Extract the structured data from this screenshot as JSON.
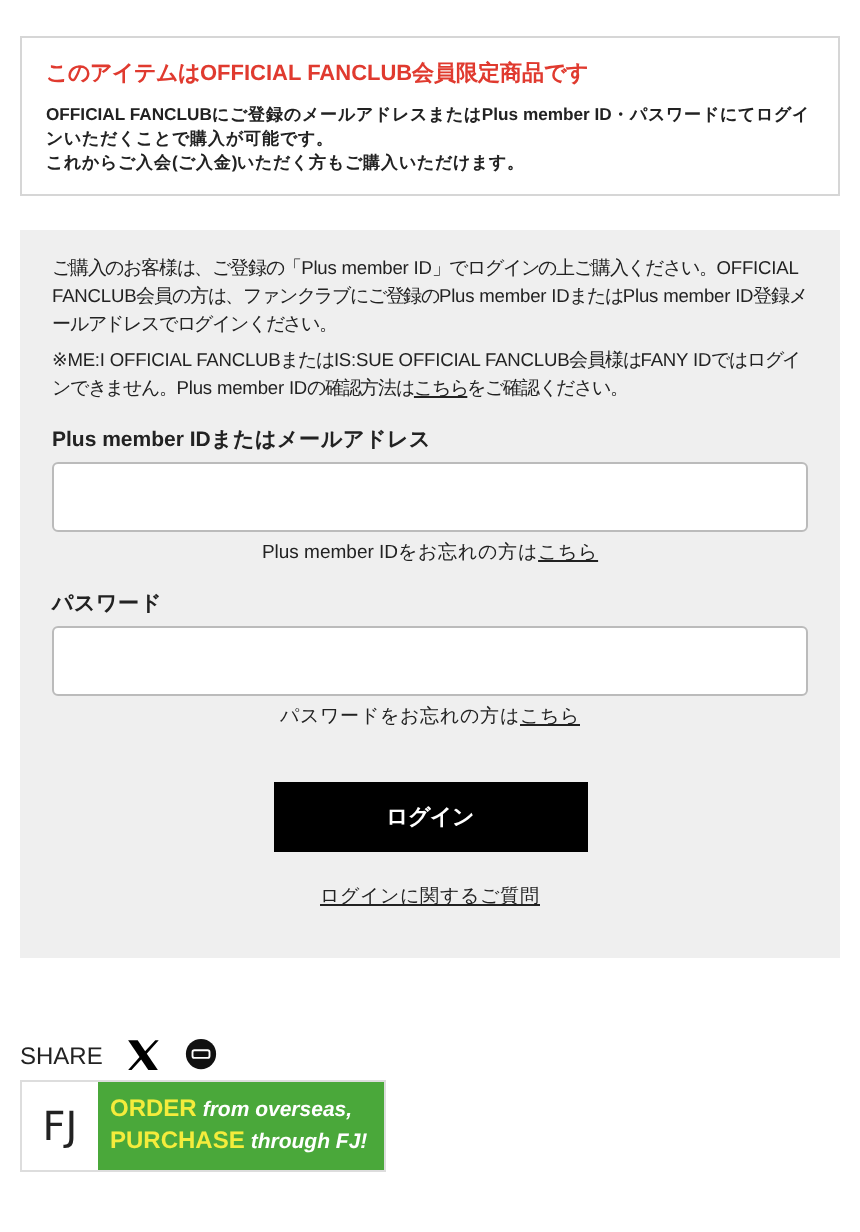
{
  "notice": {
    "title": "このアイテムはOFFICIAL FANCLUB会員限定商品です",
    "paragraphs": [
      "OFFICIAL FANCLUBにご登録のメールアドレスまたはPlus member ID・パスワードにてログインいただくことで購入が可能です。",
      "これからご入会(ご入金)いただく方もご購入いただけます。"
    ]
  },
  "login": {
    "intro": [
      "ご購入のお客様は、ご登録の「Plus member ID」でログインの上ご購入ください。OFFICIAL FANCLUB会員の方は、ファンクラブにご登録のPlus member IDまたはPlus member ID登録メールアドレスでログインください。"
    ],
    "note": {
      "before": "※ME:I OFFICIAL FANCLUBまたはIS:SUE OFFICIAL FANCLUB会員様はFANY IDではログインできません。Plus member IDの確認方法は",
      "link": "こちら",
      "after": "をご確認ください。"
    },
    "fields": [
      {
        "label": "Plus member IDまたはメールアドレス",
        "hint": "Plus member IDをお忘れの方は",
        "hint_link": "こちら"
      },
      {
        "label": "パスワード",
        "hint": "パスワードをお忘れの方は",
        "hint_link": "こちら"
      }
    ],
    "button": "ログイン",
    "faq_link": "ログインに関するご質問"
  },
  "share": {
    "label": "SHARE"
  },
  "banner": {
    "logo": "FJ",
    "lines": [
      [
        {
          "text": "ORDER",
          "kind": "highlight"
        },
        {
          "text": "from overseas,",
          "kind": "plain"
        }
      ],
      [
        {
          "text": "PURCHASE",
          "kind": "highlight"
        },
        {
          "text": "through FJ!",
          "kind": "plain"
        }
      ]
    ]
  }
}
